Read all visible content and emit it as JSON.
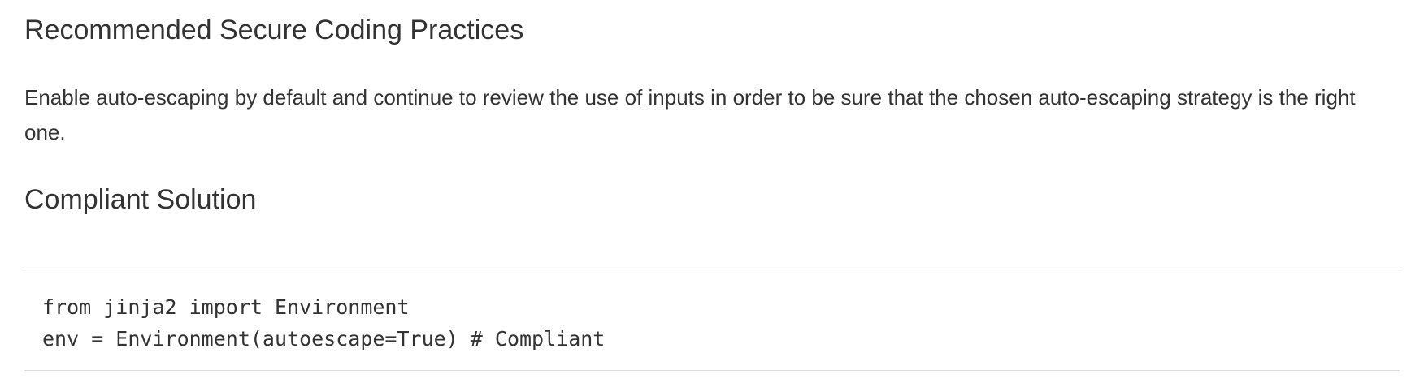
{
  "sections": {
    "practices_heading": "Recommended Secure Coding Practices",
    "practices_text": "Enable auto-escaping by default and continue to review the use of inputs in order to be sure that the chosen auto-escaping strategy is the right one.",
    "solution_heading": "Compliant Solution"
  },
  "code": {
    "lines": [
      "from jinja2 import Environment",
      "env = Environment(autoescape=True) # Compliant"
    ]
  }
}
